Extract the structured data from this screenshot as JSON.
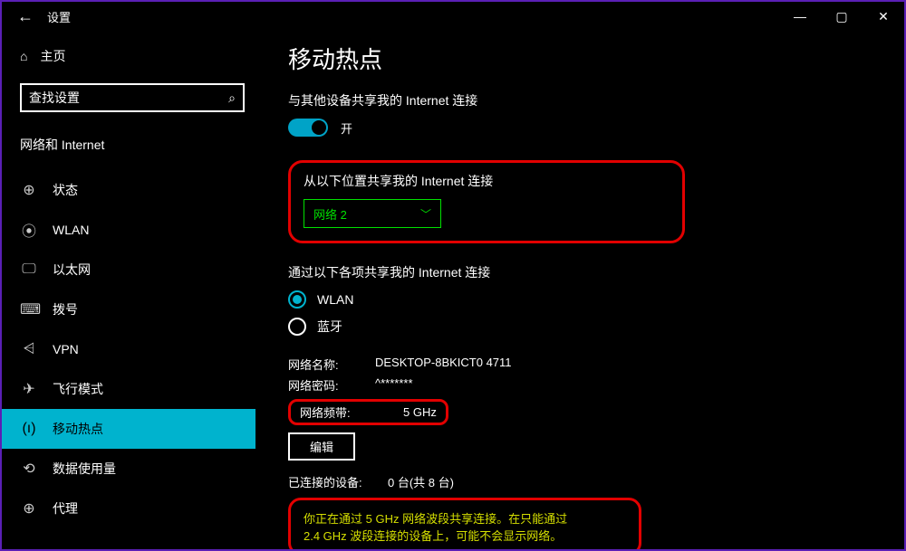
{
  "window": {
    "app_title": "设置",
    "min": "—",
    "max": "▢",
    "close": "✕"
  },
  "sidebar": {
    "home_label": "主页",
    "search_placeholder": "查找设置",
    "section_header": "网络和 Internet",
    "items": [
      {
        "icon": "⊕",
        "label": "状态"
      },
      {
        "icon": "⦿",
        "label": "WLAN"
      },
      {
        "icon": "🖵",
        "label": "以太网"
      },
      {
        "icon": "⌨",
        "label": "拨号"
      },
      {
        "icon": "⩤",
        "label": "VPN"
      },
      {
        "icon": "✈",
        "label": "飞行模式"
      },
      {
        "icon": "(ı)",
        "label": "移动热点"
      },
      {
        "icon": "⟲",
        "label": "数据使用量"
      },
      {
        "icon": "⊕",
        "label": "代理"
      }
    ]
  },
  "main": {
    "page_title": "移动热点",
    "share_label": "与其他设备共享我的 Internet 连接",
    "toggle_state": "开",
    "share_from_label": "从以下位置共享我的 Internet 连接",
    "share_from_value": "网络 2",
    "share_via_label": "通过以下各项共享我的 Internet 连接",
    "share_via_options": {
      "wlan": "WLAN",
      "bt": "蓝牙"
    },
    "net_name_label": "网络名称:",
    "net_name_value": "DESKTOP-8BKICT0 4711",
    "net_pass_label": "网络密码:",
    "net_pass_value": "^*******",
    "net_band_label": "网络频带:",
    "net_band_value": "5 GHz",
    "edit_label": "编辑",
    "connected_label": "已连接的设备:",
    "connected_value": "0 台(共 8 台)",
    "warning_l1": "你正在通过 5 GHz 网络波段共享连接。在只能通过",
    "warning_l2": "2.4 GHz 波段连接的设备上，可能不会显示网络。"
  }
}
